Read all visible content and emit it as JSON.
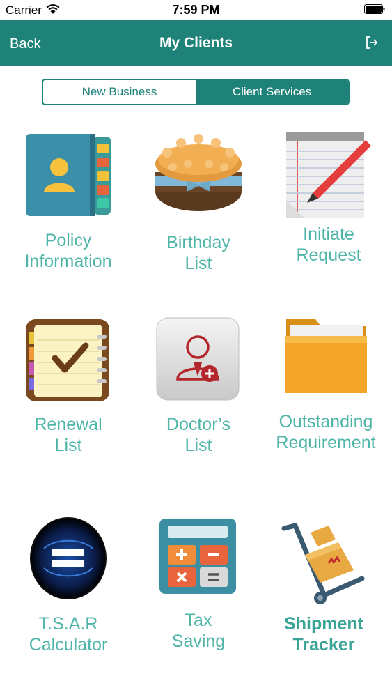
{
  "status_bar": {
    "carrier": "Carrier",
    "time": "7:59 PM"
  },
  "nav": {
    "back_label": "Back",
    "title": "My Clients"
  },
  "segments": [
    {
      "label": "New Business",
      "selected": false
    },
    {
      "label": "Client Services",
      "selected": true
    }
  ],
  "tiles": [
    {
      "label": "Policy\nInformation",
      "icon": "address-book-icon"
    },
    {
      "label": "Birthday\nList",
      "icon": "cake-icon"
    },
    {
      "label": "Initiate\nRequest",
      "icon": "notepad-pen-icon"
    },
    {
      "label": "Renewal\nList",
      "icon": "checklist-notebook-icon"
    },
    {
      "label": "Doctor’s\nList",
      "icon": "doctor-icon"
    },
    {
      "label": "Outstanding\nRequirement",
      "icon": "folder-icon"
    },
    {
      "label": "T.S.A.R\nCalculator",
      "icon": "equals-calculator-icon"
    },
    {
      "label": "Tax\nSaving",
      "icon": "calculator-icon"
    },
    {
      "label": "Shipment\nTracker",
      "icon": "hand-truck-icon"
    }
  ],
  "colors": {
    "brand": "#1e8278",
    "tile_label": "#4fb5a8"
  }
}
